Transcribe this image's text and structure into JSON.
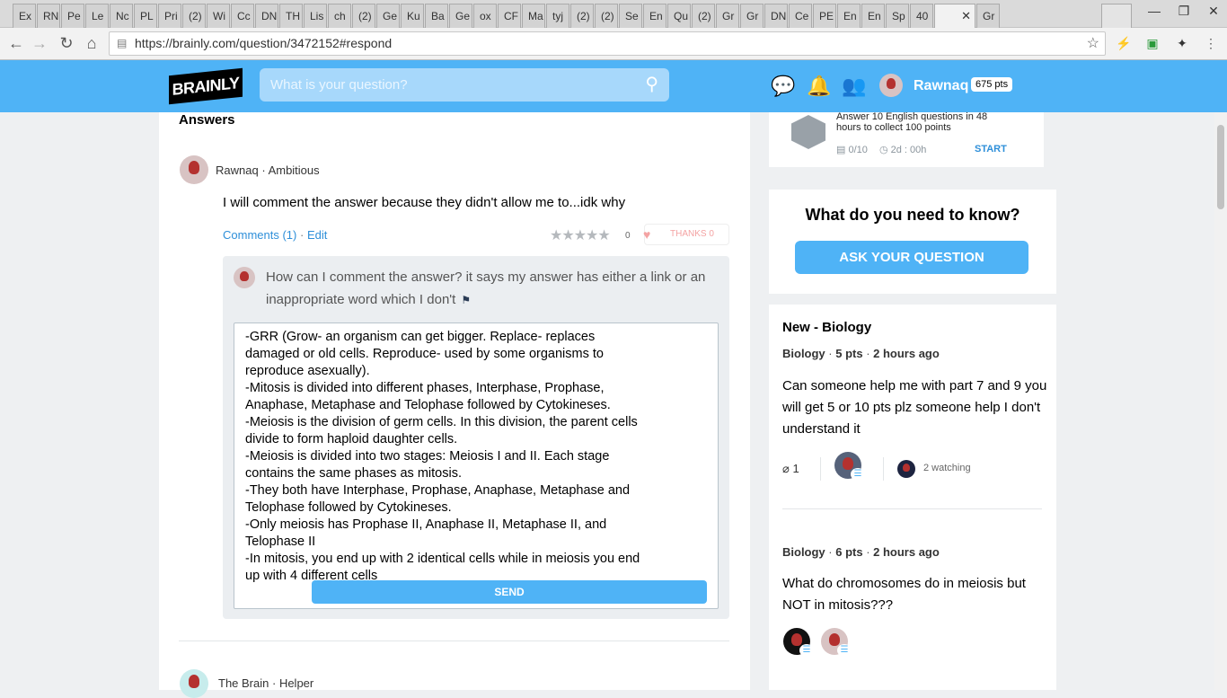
{
  "browser": {
    "tabs": [
      "Ex",
      "RN",
      "Pe",
      "Le",
      "Nc",
      "PL",
      "Pri",
      "(2)",
      "Wi",
      "Cc",
      "DN",
      "TH",
      "Lis",
      "ch",
      "(2)",
      "Ge",
      "Ku",
      "Ba",
      "Ge",
      "ox",
      "CF",
      "Ma",
      "tyj",
      "(2)",
      "(2)",
      "Se",
      "En",
      "Qu",
      "(2)",
      "Gr",
      "Gr",
      "DN",
      "Ce",
      "PE",
      "En",
      "En",
      "Sp",
      "40",
      "",
      "Gr"
    ],
    "active_tab_close": "✕",
    "url": "https://brainly.com/question/3472152#respond"
  },
  "header": {
    "logo_text": "BRAINLY",
    "search_placeholder": "What is your question?",
    "username": "Rawnaq",
    "points": "675 pts"
  },
  "answer": {
    "section_title": "Answers",
    "author": "Rawnaq",
    "rank": "Ambitious",
    "text": "I will comment the answer because they didn't allow me to...idk why",
    "comments_link": "Comments (1)",
    "edit_link": "Edit",
    "stars": "★★★★★",
    "rating_count": "0",
    "thanks_label": "THANKS",
    "thanks_count": "0",
    "comment": "How can I comment the answer? it says my answer has either a link or an inappropriate word which I don't",
    "editor_lines": [
      "-GRR (Grow- an organism can get bigger. Replace- replaces damaged or old cells. Reproduce- used by some organisms to reproduce asexually).",
      "-Mitosis is divided into different phases, Interphase, Prophase, Anaphase, Metaphase and Telophase followed by Cytokineses.",
      "-Meiosis is the division of germ cells. In this division, the parent cells divide to form haploid daughter cells.",
      "-Meiosis is divided into two stages: Meiosis I and II. Each stage contains the same phases as mitosis.",
      "-They both have Interphase, Prophase, Anaphase, Metaphase and Telophase followed by Cytokineses.",
      "-Only meiosis has Prophase II, Anaphase II, Metaphase II, and Telophase II",
      "-In mitosis, you end up with 2 identical cells while in meiosis you end up with 4 different cells"
    ],
    "send_label": "SEND",
    "next_author": "The Brain",
    "next_rank": "Helper"
  },
  "sidebar": {
    "challenge_text": "Answer 10 English questions in 48 hours to collect 100 points",
    "challenge_progress": "0/10",
    "challenge_time": "2d : 00h",
    "challenge_start": "START",
    "ask_title": "What do you need to know?",
    "ask_button": "ASK YOUR QUESTION",
    "new_title": "New - Biology",
    "questions": [
      {
        "subject": "Biology",
        "points": "5 pts",
        "time": "2 hours ago",
        "text": "Can someone help me with part 7 and 9 you will get 5 or 10 pts plz someone help I don't understand it",
        "attachments": "1",
        "watching": "2 watching"
      },
      {
        "subject": "Biology",
        "points": "6 pts",
        "time": "2 hours ago",
        "text": "What do chromosomes do in meiosis but NOT in mitosis???"
      }
    ]
  }
}
